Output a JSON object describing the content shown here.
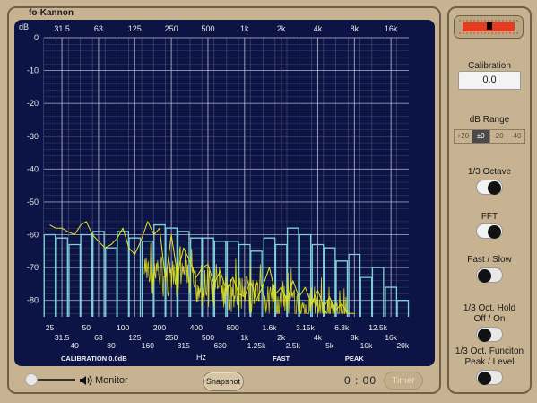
{
  "app": {
    "title": "fo-Kannon"
  },
  "chart_data": {
    "type": "line",
    "ylabel": "dB",
    "ylim": [
      -85,
      0
    ],
    "y_ticks": [
      0,
      -10,
      -20,
      -30,
      -40,
      -50,
      -60,
      -70,
      -80
    ],
    "y_tick_labels": [
      "0",
      "-10",
      "-20",
      "-30",
      "-40",
      "-50",
      "-60",
      "-70",
      "-80"
    ],
    "top_freq_labels": [
      "31.5",
      "63",
      "125",
      "250",
      "500",
      "1k",
      "2k",
      "4k",
      "8k",
      "16k"
    ],
    "bottom_row1": [
      "25",
      "50",
      "100",
      "200",
      "400",
      "800",
      "1.6k",
      "3.15k",
      "6.3k",
      "12.5k"
    ],
    "bottom_row2": [
      "31.5",
      "63",
      "125",
      "250",
      "500",
      "1k",
      "2k",
      "4k",
      "8k",
      "16k"
    ],
    "bottom_row3": [
      "40",
      "80",
      "160",
      "315",
      "630",
      "1.25k",
      "2.5k",
      "5k",
      "10k",
      "20k"
    ],
    "bands": [
      "25",
      "31.5",
      "40",
      "50",
      "63",
      "80",
      "100",
      "125",
      "160",
      "200",
      "250",
      "315",
      "400",
      "500",
      "630",
      "800",
      "1k",
      "1.25k",
      "1.6k",
      "2k",
      "2.5k",
      "3.15k",
      "4k",
      "5k",
      "6.3k",
      "8k",
      "10k",
      "12.5k",
      "16k",
      "20k"
    ],
    "band_levels_db": [
      -60,
      -61,
      -63,
      -60,
      -59,
      -64,
      -59,
      -61,
      -62,
      -57,
      -58,
      -59,
      -61,
      -61,
      -62,
      -62,
      -63,
      -65,
      -61,
      -63,
      -58,
      -60,
      -63,
      -64,
      -68,
      -66,
      -73,
      -70,
      -76,
      -80
    ],
    "fft_series": {
      "name": "FFT",
      "color": "#e6e61e",
      "x_hz": [
        25,
        28,
        31.5,
        35,
        40,
        45,
        50,
        56,
        63,
        71,
        80,
        90,
        100,
        112,
        125,
        140,
        160,
        180,
        200,
        224,
        250,
        280,
        315,
        355,
        400,
        450,
        500,
        560,
        630,
        710,
        800,
        900,
        1000,
        1120,
        1250,
        1400,
        1600,
        1800,
        2000,
        2240,
        2500,
        2800,
        3150,
        3550,
        4000,
        4500,
        5000,
        5600,
        6300,
        7100,
        8000
      ],
      "y_db": [
        -57,
        -58,
        -58,
        -59,
        -60,
        -57,
        -56,
        -60,
        -62,
        -64,
        -63,
        -61,
        -58,
        -64,
        -66,
        -62,
        -56,
        -60,
        -58,
        -74,
        -60,
        -72,
        -64,
        -68,
        -73,
        -70,
        -69,
        -75,
        -71,
        -77,
        -73,
        -78,
        -79,
        -74,
        -80,
        -76,
        -70,
        -78,
        -76,
        -80,
        -74,
        -79,
        -76,
        -81,
        -77,
        -82,
        -79,
        -83,
        -81,
        -84,
        -84
      ]
    }
  },
  "status": {
    "calibration": "CALIBRATION 0.0dB",
    "hz": "Hz",
    "speed": "FAST",
    "mode": "PEAK"
  },
  "footer": {
    "monitor_label": "Monitor",
    "snapshot_label": "Snapshot",
    "time": "0 : 00",
    "timer_label": "Timer"
  },
  "sidebar": {
    "calibration_label": "Calibration",
    "calibration_value": "0.0",
    "db_range_label": "dB Range",
    "db_range_options": [
      "+20",
      "±0",
      "-20",
      "-40"
    ],
    "db_range_selected": "±0",
    "third_octave_label": "1/3 Octave",
    "fft_label": "FFT",
    "fast_slow_label": "Fast / Slow",
    "hold_label_line1": "1/3 Oct. Hold",
    "hold_label_line2": "Off / On",
    "function_label_line1": "1/3 Oct. Funciton",
    "function_label_line2": "Peak / Level"
  },
  "toggles": {
    "third_octave": true,
    "fft": true,
    "fast_slow": false,
    "hold": false,
    "function": false
  },
  "colors": {
    "panel_bg": "#0c1445",
    "grid": "#c9c9d9",
    "bars": "#7fd0d8",
    "fft": "#e6e61e",
    "meter_red": "#e83a1f"
  }
}
